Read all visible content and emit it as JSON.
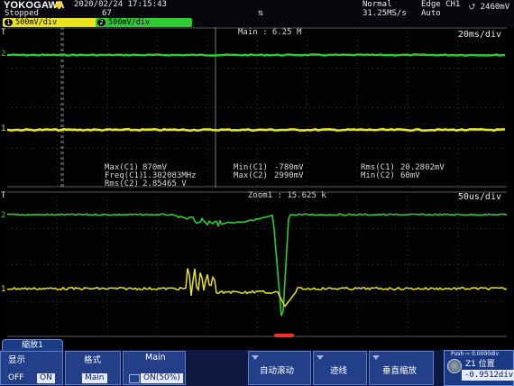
{
  "header": {
    "brand": "YOKOGAWA",
    "datetime": "2020/02/24  17:15:43",
    "acq_state": "Stopped",
    "acq_count": "67",
    "zoom_glyph": "⇅",
    "trigger_mode": "Normal",
    "sample_rate": "31.25MS/s",
    "trigger_setting": "Edge CH1",
    "trigger_slope_icon": "rising-falling-edge-icon",
    "trigger_arrow": "⮍ 2460mV",
    "trigger_mode2": "Auto",
    "ch1": {
      "num": "1",
      "scale": "500mV/div",
      "color": "#e9e41c"
    },
    "ch2": {
      "num": "2",
      "scale": "500mV/div",
      "color": "#2fcb35"
    }
  },
  "main_pane": {
    "title": "Main : 6.25 M",
    "timebase": "20ms/div",
    "marker_top": "T",
    "ch2_marker": "2",
    "ch1_marker": "1",
    "measurements": [
      {
        "name": "Max(C1)",
        "value": "870mV"
      },
      {
        "name": "Freq(C1)",
        "value": "1.302083MHz"
      },
      {
        "name": "Rms(C2)",
        "value": "2.85465 V"
      },
      {
        "name": "Min(C1)",
        "value": "-780mV"
      },
      {
        "name": "Max(C2)",
        "value": "2990mV"
      },
      {
        "name": "Rms(C1)",
        "value": "20.2802mV"
      },
      {
        "name": "Min(C2)",
        "value": "60mV"
      }
    ]
  },
  "zoom_pane": {
    "title": "Zoom1 : 15.625 k",
    "timebase": "50us/div",
    "marker_top": "T",
    "ch2_marker": "2",
    "ch1_marker": "1"
  },
  "menu": {
    "tab": "縮放1",
    "display": {
      "label": "显示",
      "off": "OFF",
      "on": "ON"
    },
    "format": {
      "label": "格式",
      "value": "Main"
    },
    "main": {
      "label": "Main",
      "value": "ON(50%)"
    },
    "autoscroll": {
      "label": "自动滚动"
    },
    "trace": {
      "label": "迹线"
    },
    "vzoom": {
      "label": "垂直缩放"
    },
    "zoom_position": {
      "push_label": "Push ⇨ 0.0000div",
      "label": "Z1 位置",
      "value": "-0.9512div"
    }
  },
  "colors": {
    "ch1": "#e9e41c",
    "ch2": "#2fcb35",
    "grid": "#3c3c3c",
    "menu": "#233f8a",
    "marker": "#ff2a2a"
  }
}
